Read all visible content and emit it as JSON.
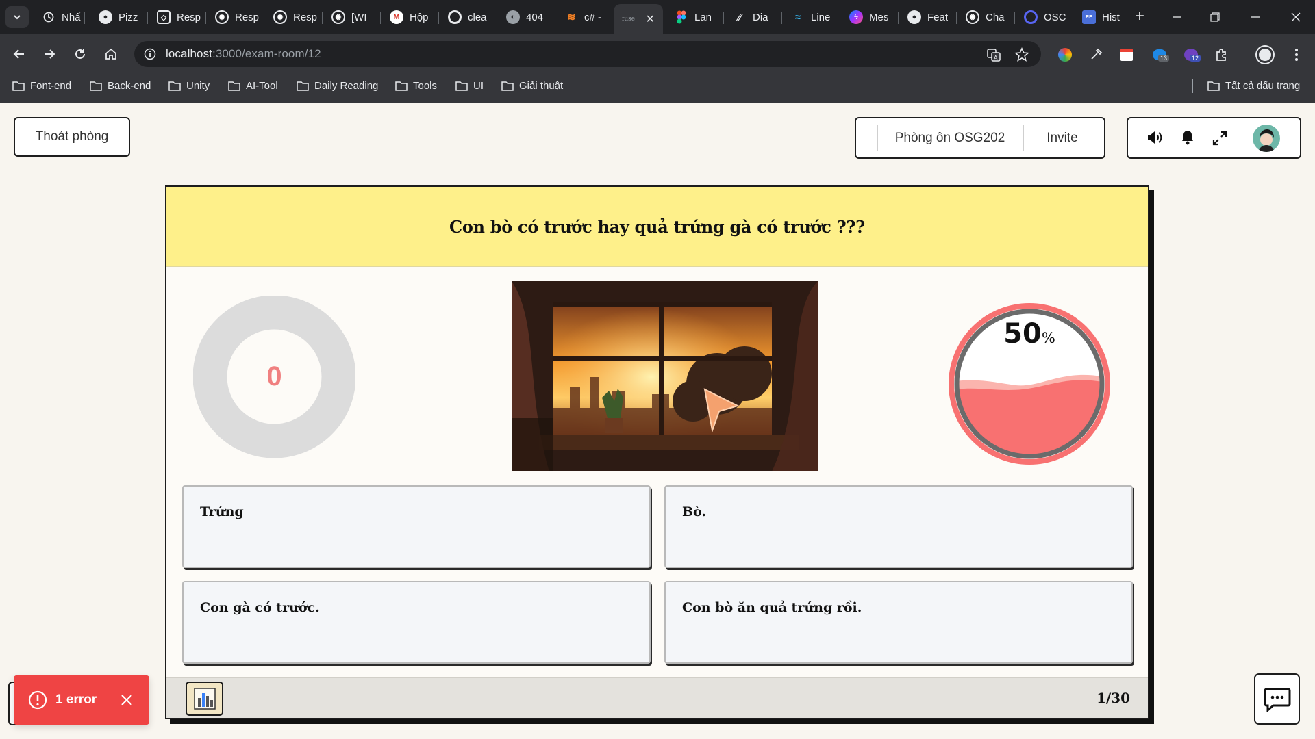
{
  "browser": {
    "tabs": [
      {
        "label": "Nhấ",
        "icon": "history-icon"
      },
      {
        "label": "Pizz",
        "icon": "github-icon"
      },
      {
        "label": "Resp",
        "icon": "codepen-icon"
      },
      {
        "label": "Resp",
        "icon": "openai-icon"
      },
      {
        "label": "Resp",
        "icon": "openai-icon"
      },
      {
        "label": "[WI",
        "icon": "openai-icon"
      },
      {
        "label": "Hộp",
        "icon": "gmail-icon"
      },
      {
        "label": "clea",
        "icon": "chrome-icon"
      },
      {
        "label": "404",
        "icon": "globe-icon"
      },
      {
        "label": "c# -",
        "icon": "stackoverflow-icon"
      },
      {
        "label": "fuse",
        "icon": "fuse-icon",
        "active": true
      },
      {
        "label": "Lan",
        "icon": "figma-icon"
      },
      {
        "label": "Dia",
        "icon": "slash-icon"
      },
      {
        "label": "Line",
        "icon": "tailwind-icon"
      },
      {
        "label": "Mes",
        "icon": "messenger-icon"
      },
      {
        "label": "Feat",
        "icon": "github-copilot-icon"
      },
      {
        "label": "Cha",
        "icon": "openai-icon"
      },
      {
        "label": "OSC",
        "icon": "q-icon"
      },
      {
        "label": "Hist",
        "icon": "repo-icon"
      }
    ],
    "url_host": "localhost",
    "url_rest": ":3000/exam-room/12",
    "extension_badges": {
      "first": "13",
      "second": "12"
    },
    "bookmarks": [
      "Font-end",
      "Back-end",
      "Unity",
      "AI-Tool",
      "Daily Reading",
      "Tools",
      "UI",
      "Giải thuật"
    ],
    "all_bookmarks": "Tất cả dấu trang"
  },
  "header": {
    "leave_label": "Thoát phòng",
    "room_name": "Phòng ôn OSG202",
    "invite_label": "Invite"
  },
  "quiz": {
    "question": "Con bò có trước hay quả trứng gà có trước ???",
    "timer_value": "0",
    "progress_value": "50",
    "progress_unit": "%",
    "progress_fraction": 0.5,
    "answers": [
      "Trứng",
      "Bò.",
      "Con gà có trước.",
      "Con bò ăn quả trứng rồi."
    ],
    "counter": "1/30"
  },
  "toast": {
    "text": "1 error"
  },
  "colors": {
    "question_bg": "#fef08a",
    "accent_red": "#f87171",
    "timer_text": "#f08080",
    "toast_bg": "#ef4444"
  }
}
